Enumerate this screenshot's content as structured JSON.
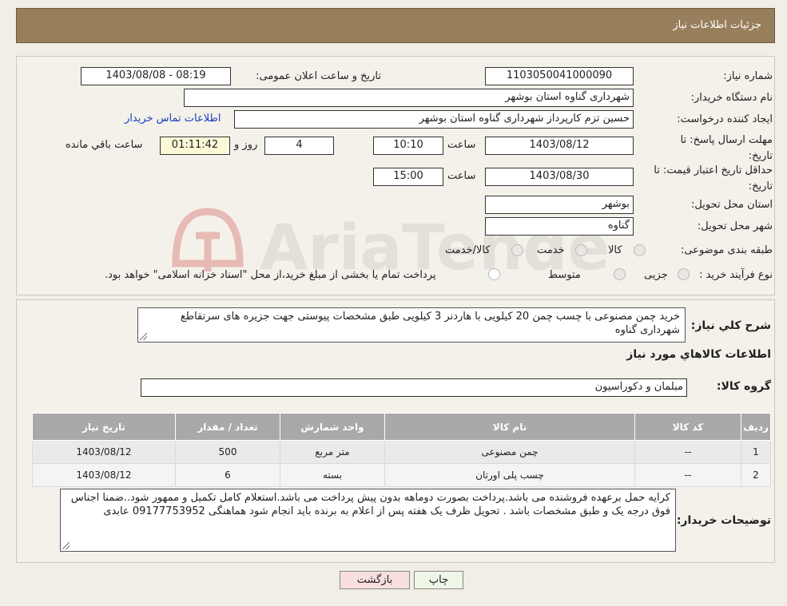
{
  "header": {
    "title": "جزئیات اطلاعات نیاز"
  },
  "form": {
    "need_number": {
      "label": "شماره نیاز:",
      "value": "1103050041000090"
    },
    "announce": {
      "label": "تاریخ و ساعت اعلان عمومی:",
      "value": "1403/08/08 - 08:19"
    },
    "buyer_org": {
      "label": "نام دستگاه خریدار:",
      "value": "شهرداری گناوه استان بوشهر"
    },
    "requester": {
      "label": "ایجاد کننده درخواست:",
      "value": "حسین تزم کارپرداز شهرداری گناوه استان بوشهر",
      "contact_link": "اطلاعات تماس خریدار"
    },
    "deadline": {
      "label": "مهلت ارسال پاسخ: تا تاریخ:",
      "date": "1403/08/12",
      "time_label": "ساعت",
      "time": "10:10",
      "days": "4",
      "days_label": "روز و",
      "remaining": "01:11:42",
      "remaining_label": "ساعت باقي مانده"
    },
    "validity": {
      "label": "حداقل تاریخ اعتبار قیمت: تا تاریخ:",
      "date": "1403/08/30",
      "time_label": "ساعت",
      "time": "15:00"
    },
    "province": {
      "label": "استان محل تحویل:",
      "value": "بوشهر"
    },
    "city": {
      "label": "شهر محل تحویل:",
      "value": "گناوه"
    },
    "category": {
      "label": "طبقه بندی موضوعی:",
      "options": [
        "کالا",
        "خدمت",
        "کالا/خدمت"
      ]
    },
    "purchase_type": {
      "label": "نوع فرآیند خرید :",
      "options": [
        "جزیی",
        "متوسط"
      ],
      "note": "پرداخت تمام یا بخشی از مبلغ خرید،از محل \"اسناد خزانه اسلامی\" خواهد بود."
    }
  },
  "summary": {
    "label": "شرح کلي نیاز:",
    "text": "خرید چمن مصنوعی با چسب چمن 20 کیلویی با هاردنر 3 کیلویی طبق مشخصات پیوستی جهت جزیره های سرتقاطع شهرداری گناوه"
  },
  "goods_info": {
    "title": "اطلاعات کالاهاي مورد نیاز"
  },
  "goods_group": {
    "label": "گروه کالا:",
    "value": "مبلمان و دکوراسیون"
  },
  "table": {
    "headers": [
      "ردیف",
      "کد کالا",
      "نام کالا",
      "واحد شمارش",
      "تعداد / مقدار",
      "تاریخ نیاز"
    ],
    "rows": [
      [
        "1",
        "--",
        "چمن مصنوعی",
        "متر مربع",
        "500",
        "1403/08/12"
      ],
      [
        "2",
        "--",
        "چسب پلی اورتان",
        "بسته",
        "6",
        "1403/08/12"
      ]
    ]
  },
  "buyer_notes": {
    "label": "توضیحات خریدار:",
    "text": "کرایه حمل برعهده فروشنده می باشد.پرداخت بصورت دوماهه بدون پیش پرداخت می باشد.استعلام کامل تکمیل و ممهور شود..ضمنا اجناس فوق درجه یک  و طبق مشخصات باشد . تحویل ظرف یک هفته پس از اعلام به برنده باید انجام شود هماهنگی 09177753952 عابدی"
  },
  "buttons": {
    "print": "چاپ",
    "back": "بازگشت"
  },
  "watermark": {
    "text": "AriaTender.neT"
  },
  "colors": {
    "header": "#987f5c",
    "table_header": "#a9a9a9",
    "back_button": "#f8dede",
    "print_button": "#eef7e6",
    "timer_box": "#fcf8d8"
  }
}
